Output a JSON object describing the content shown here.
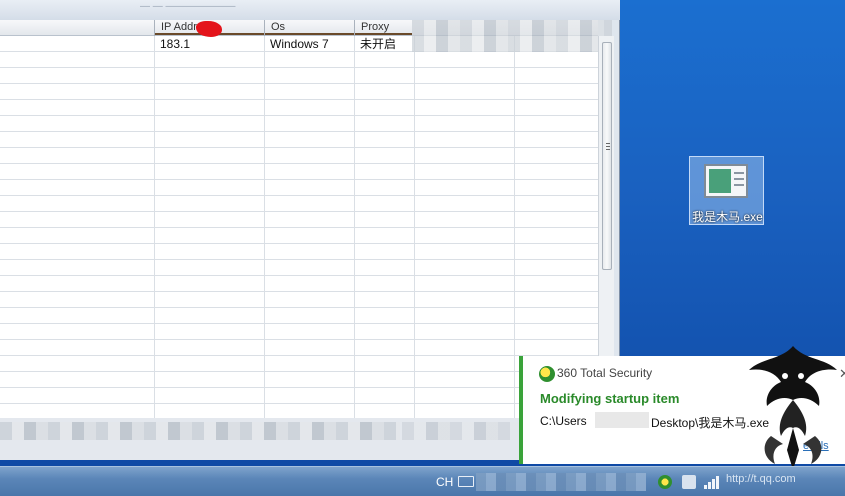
{
  "window": {
    "title": "— — ———————"
  },
  "table": {
    "columns": [
      {
        "key": "ip",
        "label": "IP Address"
      },
      {
        "key": "os",
        "label": "Os"
      },
      {
        "key": "proxy",
        "label": "Proxy"
      }
    ],
    "rows": [
      {
        "ip": "183.1",
        "os": "Windows 7",
        "proxy": "未开启"
      }
    ]
  },
  "desktop": {
    "icon_label": "我是木马.exe",
    "icon_name": "exe-file-icon"
  },
  "notification": {
    "app_name": "360 Total Security",
    "heading": "Modifying startup item",
    "path_prefix": "C:\\Users",
    "path_suffix": "Desktop\\我是木马.exe",
    "details_label": "etails",
    "close_glyph": "✕",
    "accent_color": "#3aa33a"
  },
  "taskbar": {
    "language": "CH",
    "watermark": "http://t.qq.com"
  }
}
